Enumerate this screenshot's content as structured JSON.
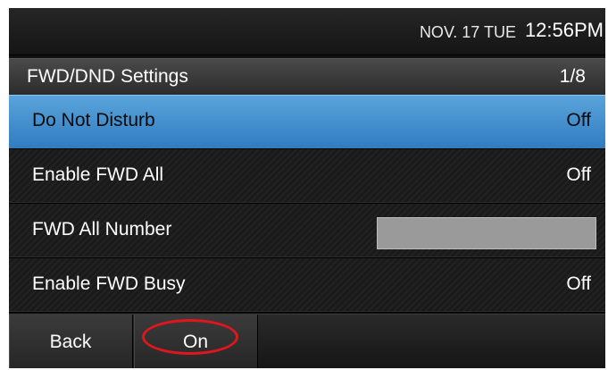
{
  "status": {
    "date": "NOV. 17 TUE",
    "time": "12:56PM"
  },
  "header": {
    "title": "FWD/DND Settings",
    "page": "1/8"
  },
  "settings": [
    {
      "label": "Do Not Disturb",
      "value": "Off",
      "selected": true
    },
    {
      "label": "Enable FWD All",
      "value": "Off",
      "selected": false
    },
    {
      "label": "FWD All Number",
      "value": "",
      "selected": false
    },
    {
      "label": "Enable FWD Busy",
      "value": "Off",
      "selected": false
    }
  ],
  "softkeys": {
    "back": "Back",
    "on": "On"
  },
  "colors": {
    "selection": "#3a88cc",
    "highlight_ring": "#e0161c"
  }
}
